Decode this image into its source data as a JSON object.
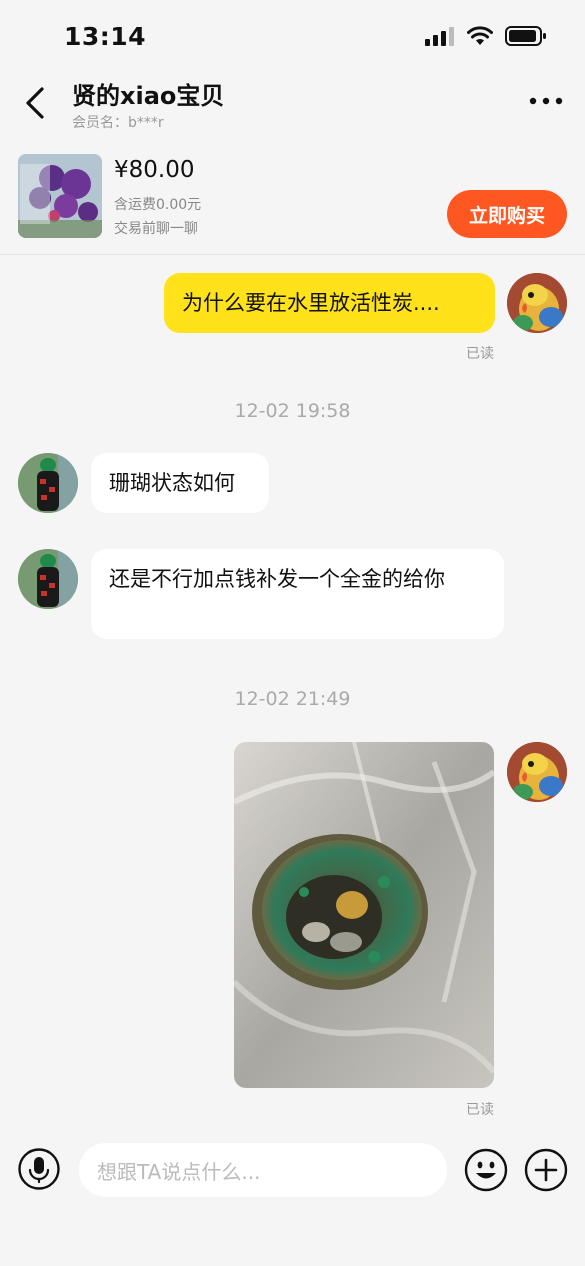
{
  "status_bar": {
    "time": "13:14"
  },
  "header": {
    "title": "贤的xiao宝贝",
    "member": "会员名：b***r"
  },
  "product": {
    "price": "¥80.00",
    "shipping": "含运费0.00元",
    "note": "交易前聊一聊",
    "buy_label": "立即购买"
  },
  "messages": {
    "m1": {
      "text": "为什么要在水里放活性炭....",
      "read": "已读"
    },
    "ts1": "12-02 19:58",
    "m2": {
      "text": "珊瑚状态如何"
    },
    "m3": {
      "text": "还是不行加点钱补发一个全金的给你"
    },
    "ts2": "12-02 21:49",
    "m4": {
      "read": "已读"
    }
  },
  "input_bar": {
    "placeholder": "想跟TA说点什么..."
  },
  "colors": {
    "accent": "#ff5722",
    "my_bubble": "#ffe21a"
  }
}
